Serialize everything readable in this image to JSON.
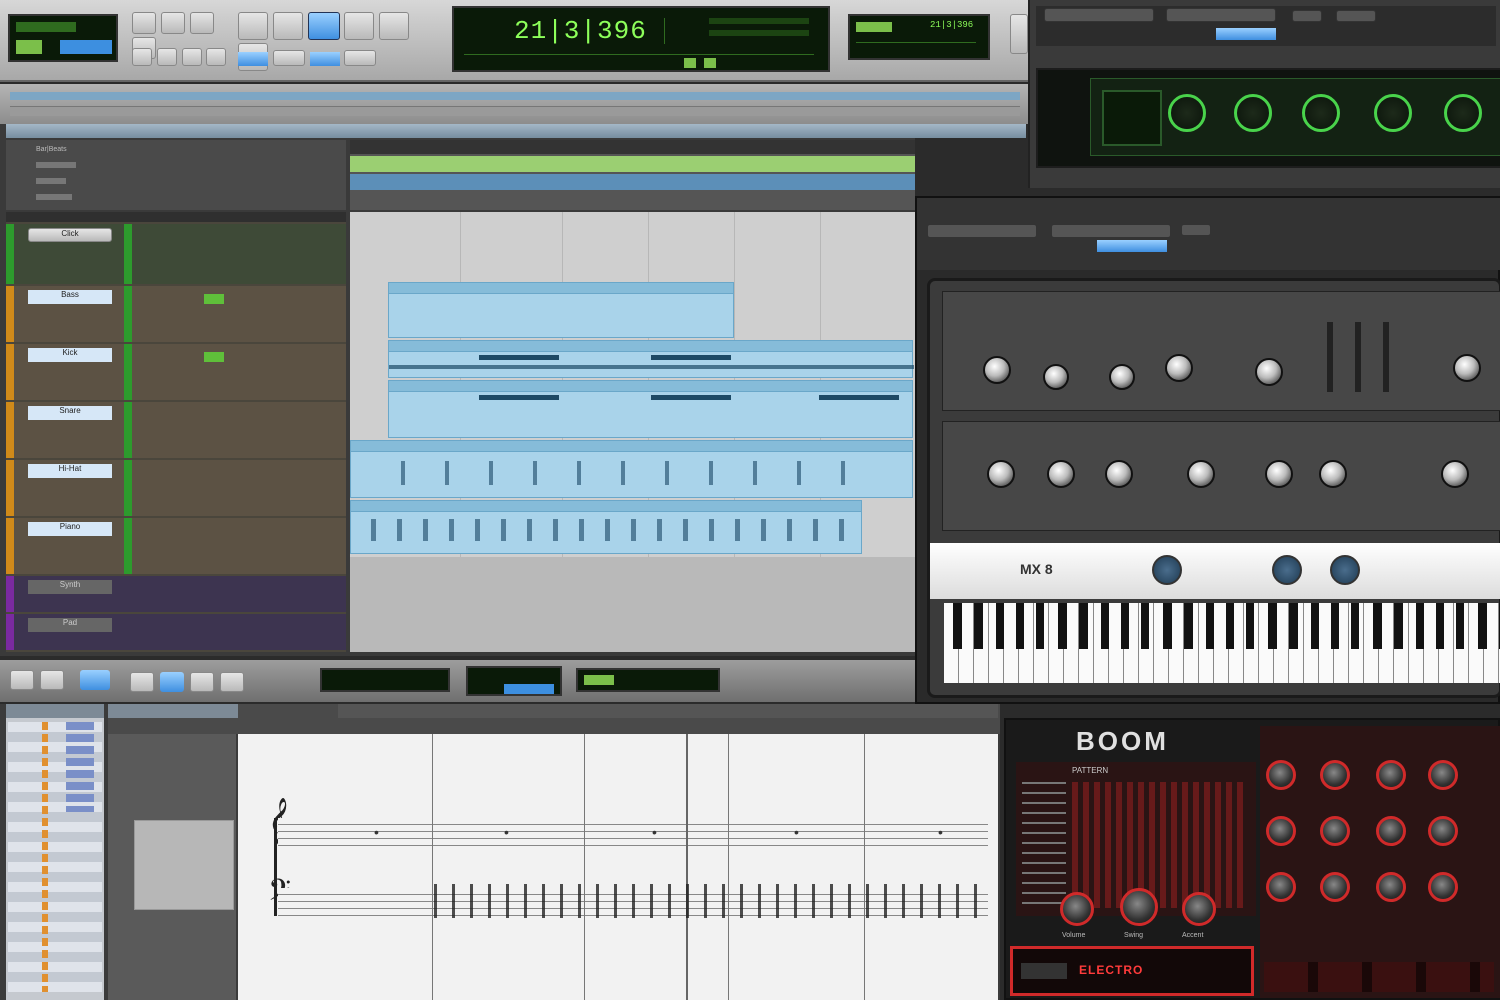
{
  "transport": {
    "counter_main": "21|3|396",
    "counter_sub": "21|3|396"
  },
  "markers": {
    "ruler_label": "Bar|Beats"
  },
  "edit": {
    "track_names": [
      "Click",
      "Bass",
      "Kick",
      "Snare",
      "Hi-Hat",
      "Piano",
      "Synth",
      "Pad"
    ]
  },
  "boom": {
    "title": "BOOM",
    "preset": "ELECTRO",
    "pattern_label": "PATTERN",
    "knob_labels": [
      "Volume",
      "Swing",
      "Accent"
    ]
  },
  "synth": {
    "model_label": "MX 8"
  },
  "score": {
    "clef_treble": "𝄞",
    "clef_bass": "𝄢"
  },
  "colors": {
    "accent_green": "#8dff5a",
    "clip_blue": "#a9d3ea",
    "boom_red": "#d02a2a",
    "plugin_green": "#49d34b"
  }
}
